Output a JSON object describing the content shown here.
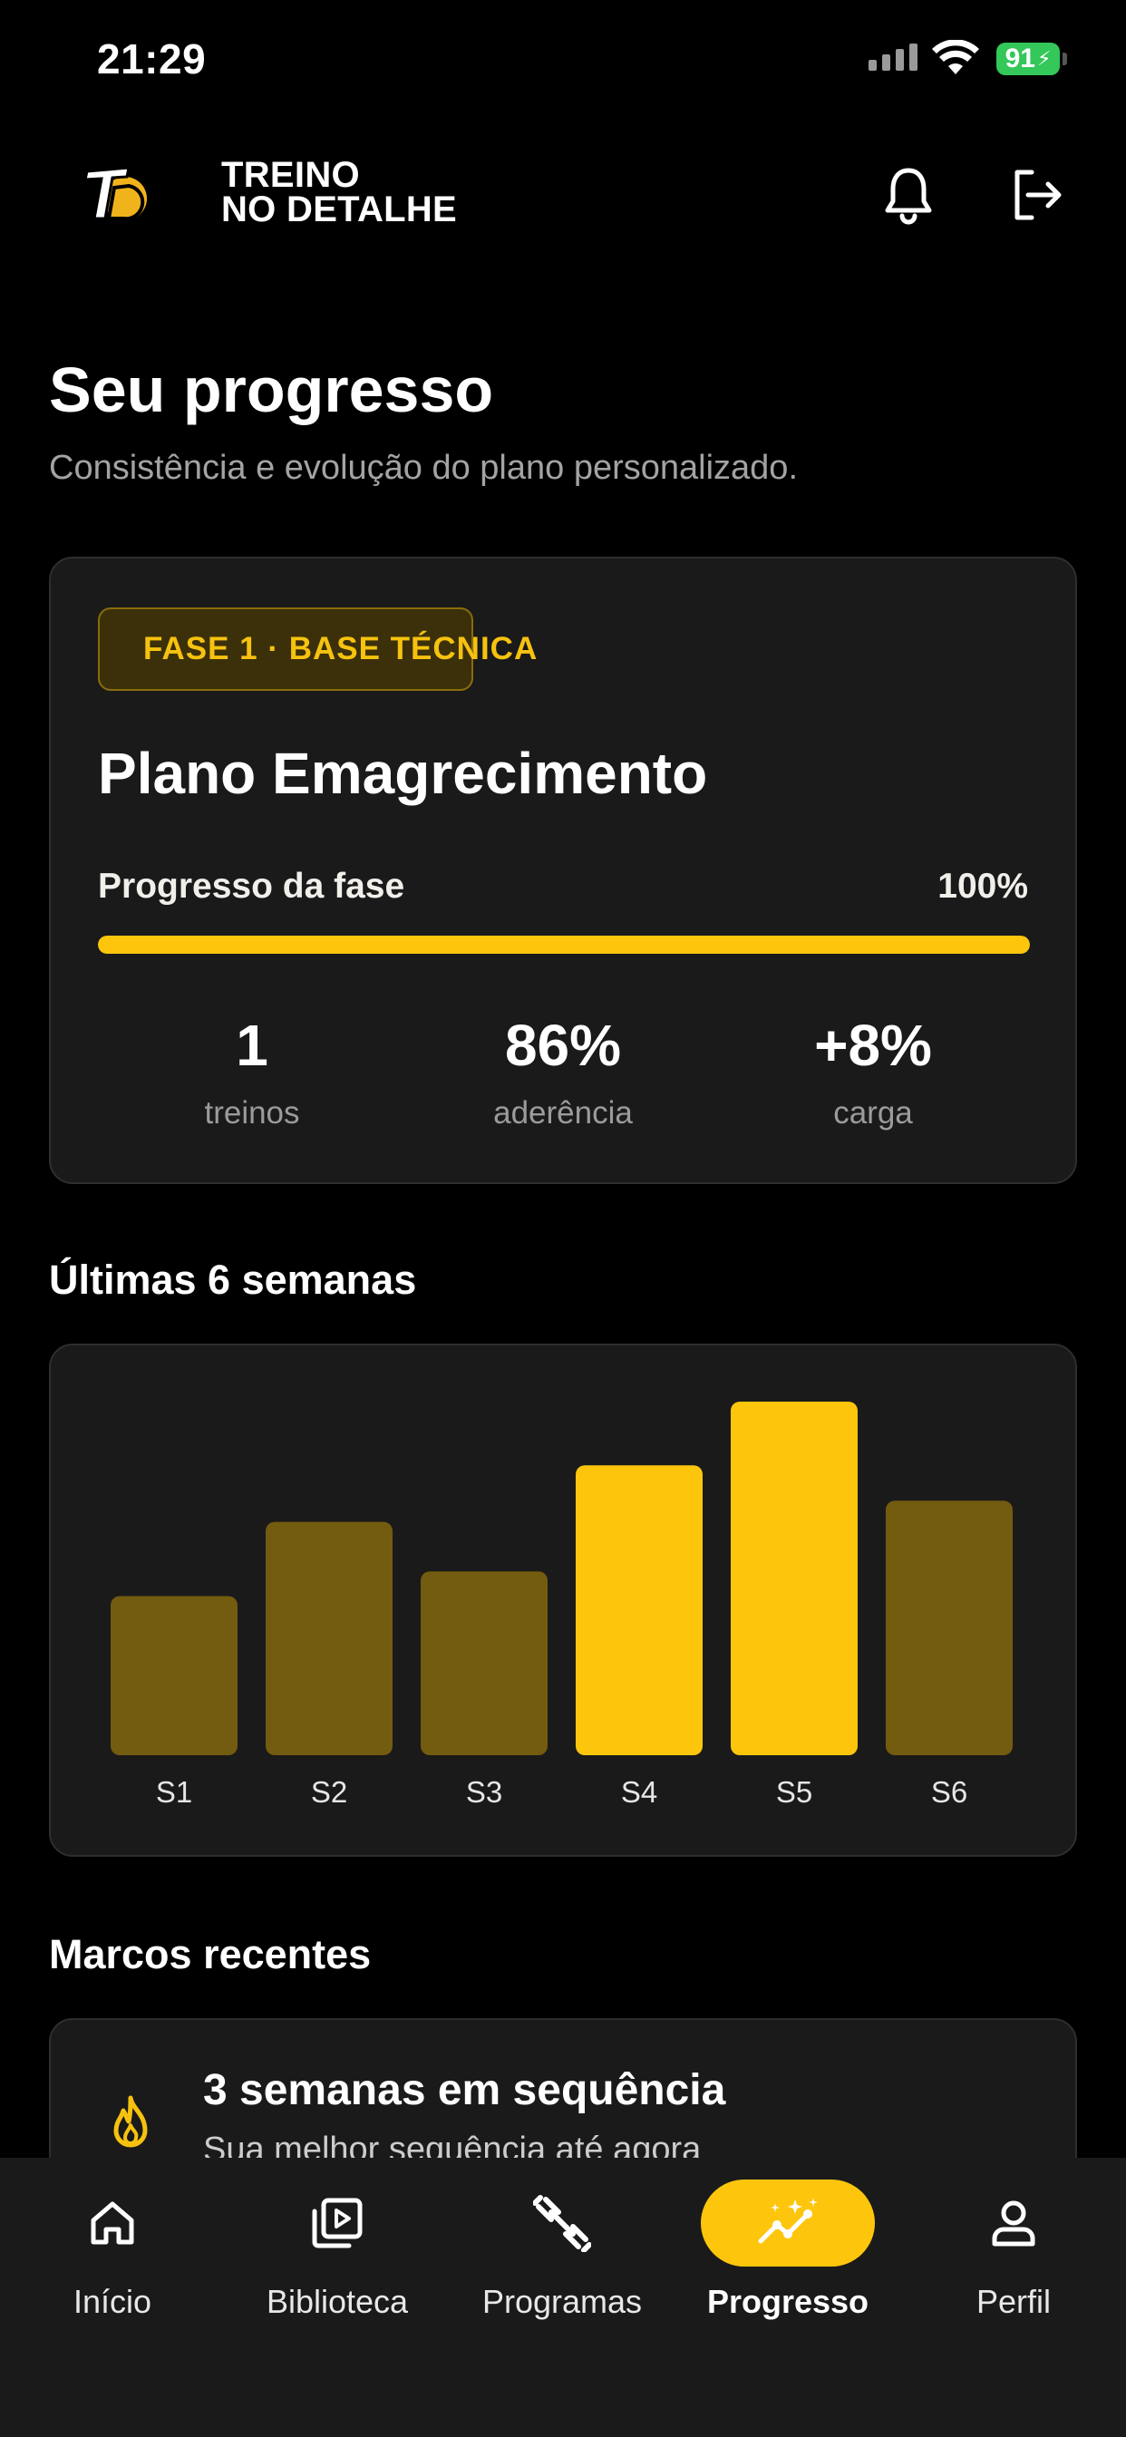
{
  "status_bar": {
    "time": "21:29",
    "battery": "91"
  },
  "header": {
    "brand_line1": "TREINO",
    "brand_line2": "NO DETALHE",
    "logo_icon": "brand-logo-icon",
    "bell_icon": "bell-icon",
    "logout_icon": "logout-icon"
  },
  "page": {
    "title": "Seu progresso",
    "subtitle": "Consistência e evolução do plano personalizado."
  },
  "plan": {
    "badge": "FASE 1 · BASE TÉCNICA",
    "name": "Plano Emagrecimento",
    "progress_label": "Progresso da fase",
    "progress_value": "100%",
    "progress_fraction": 1.0,
    "stats": [
      {
        "value": "1",
        "label": "treinos"
      },
      {
        "value": "86%",
        "label": "aderência"
      },
      {
        "value": "+8%",
        "label": "carga"
      }
    ]
  },
  "weeks": {
    "title": "Últimas 6 semanas"
  },
  "chart_data": {
    "type": "bar",
    "categories": [
      "S1",
      "S2",
      "S3",
      "S4",
      "S5",
      "S6"
    ],
    "values": [
      45,
      66,
      52,
      82,
      100,
      72
    ],
    "highlighted": [
      false,
      false,
      false,
      true,
      true,
      false
    ],
    "colors": {
      "highlight": "#fdc60d",
      "normal": "#735b0f"
    },
    "ylim": [
      0,
      100
    ],
    "grid": false
  },
  "milestones": {
    "title": "Marcos recentes",
    "items": [
      {
        "icon": "fire-icon",
        "title": "3 semanas em sequência",
        "subtitle": "Sua melhor sequência até agora"
      }
    ]
  },
  "nav": {
    "items": [
      {
        "label": "Início",
        "icon": "home-icon",
        "active": false
      },
      {
        "label": "Biblioteca",
        "icon": "video-library-icon",
        "active": false
      },
      {
        "label": "Programas",
        "icon": "dumbbell-icon",
        "active": false
      },
      {
        "label": "Progresso",
        "icon": "progress-chart-icon",
        "active": true
      },
      {
        "label": "Perfil",
        "icon": "user-icon",
        "active": false
      }
    ]
  },
  "colors": {
    "accent": "#fdc60d",
    "background": "#000000",
    "card": "#1a1a1a"
  }
}
